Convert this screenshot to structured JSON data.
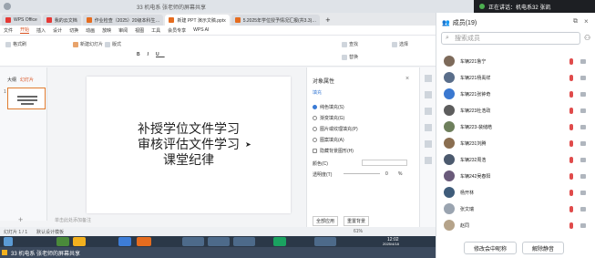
{
  "topbar": {
    "center_text": "33 机电系 张老师的屏幕共享",
    "speaking": "正在讲话：机电系32 张凯"
  },
  "tabs": [
    {
      "label": "WPS Office",
      "color": "#e53935"
    },
    {
      "label": "我的云文档",
      "color": "#e53935"
    },
    {
      "label": "作业检查（2025）20级本科生…",
      "color": "#e56c1f"
    },
    {
      "label": "新建 PPT 演示文稿.pptx",
      "color": "#e56c1f"
    },
    {
      "label": "5.2025年学位授予情况汇报(共3.3)…",
      "color": "#e56c1f"
    }
  ],
  "menus": [
    "文件",
    "开始",
    "插入",
    "设计",
    "切换",
    "动画",
    "放映",
    "审阅",
    "视图",
    "工具",
    "会员专享",
    "WPS AI"
  ],
  "active_menu": "开始",
  "toolbar": {
    "format_painter": "格式刷",
    "new_slide": "新建幻灯片",
    "layout": "版式",
    "find": "查找",
    "replace": "替换",
    "select": "选择"
  },
  "thumb": {
    "label": "大纲",
    "label2": "幻灯片",
    "number": "1"
  },
  "slide": {
    "lines": [
      "补授学位文件学习",
      "审核评估文件学习",
      "课堂纪律"
    ]
  },
  "notes_placeholder": "单击此处添加备注",
  "props": {
    "title": "对象属性",
    "tab": "填充",
    "options": [
      {
        "label": "纯色填充(S)",
        "selected": true
      },
      {
        "label": "渐变填充(G)",
        "selected": false
      },
      {
        "label": "图片或纹理填充(P)",
        "selected": false
      },
      {
        "label": "图案填充(A)",
        "selected": false
      },
      {
        "label": "隐藏背景图形(H)",
        "selected": false
      }
    ],
    "color_label": "颜色(C)",
    "transparency_label": "透明度(T)",
    "transparency_value": "0",
    "transparency_unit": "%",
    "apply_all": "全部应用",
    "reset": "重置背景"
  },
  "statusbar": {
    "slide_count": "幻灯片 1 / 1",
    "theme": "默认设计模板",
    "zoom": "61%"
  },
  "taskbar": {
    "time": "12:02",
    "date": "2025/4/18"
  },
  "share_bar": {
    "text": "33 机电系 张老师的屏幕共享"
  },
  "members": {
    "title": "成员(19)",
    "search_placeholder": "搜索成员",
    "list": [
      {
        "name": "车辆221鲁宁",
        "avatar": "#7d6a5a"
      },
      {
        "name": "车辆221杨禹祥",
        "avatar": "#5a6e8a"
      },
      {
        "name": "车辆221张钟奇",
        "avatar": "#3a78d0"
      },
      {
        "name": "车辆223杜浩政",
        "avatar": "#5d5d5d"
      },
      {
        "name": "车辆223-裴储皓",
        "avatar": "#6e7f5c"
      },
      {
        "name": "车辆231刘腾",
        "avatar": "#8a6e50"
      },
      {
        "name": "车辆232周浩",
        "avatar": "#4c5a6e"
      },
      {
        "name": "车辆242吴春阳",
        "avatar": "#6a5a7a"
      },
      {
        "name": "杨开林",
        "avatar": "#3f5c7a"
      },
      {
        "name": "张文瑞",
        "avatar": "#9aa4b0"
      },
      {
        "name": "赵同",
        "avatar": "#b5a38a"
      }
    ],
    "rename_button": "修改会中昵称",
    "mute_button": "解除静音"
  }
}
